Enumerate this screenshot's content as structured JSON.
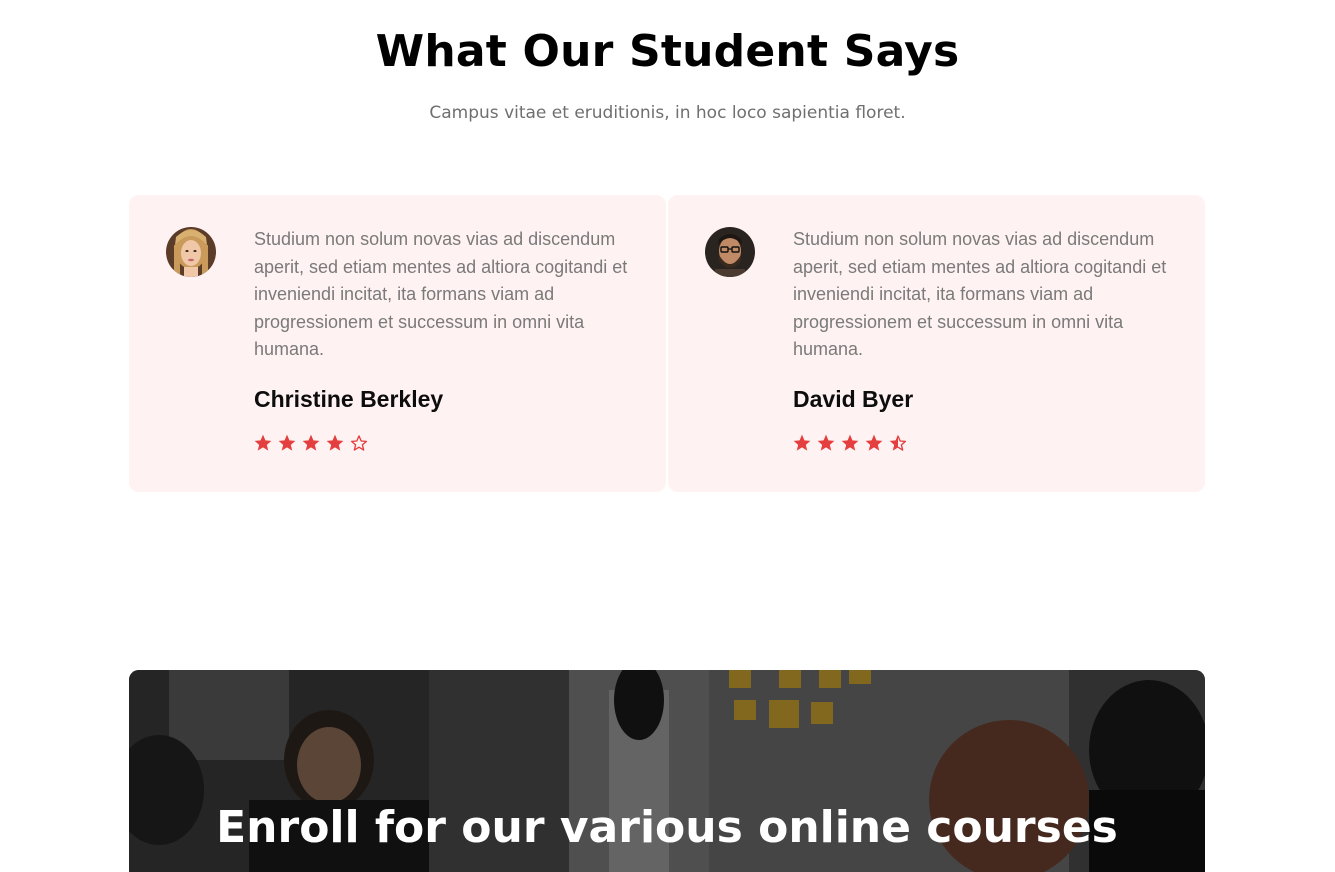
{
  "section": {
    "title": "What Our Student Says",
    "subtitle": "Campus vitae et eruditionis, in hoc loco sapientia floret."
  },
  "testimonials": [
    {
      "quote": "Studium non solum novas vias ad discendum aperit, sed etiam mentes ad altiora cogitandi et inveniendi incitat, ita formans viam ad progressionem et successum in omni vita humana.",
      "author": "Christine Berkley",
      "rating": 4,
      "avatar_icon": "avatar-woman-icon"
    },
    {
      "quote": "Studium non solum novas vias ad discendum aperit, sed etiam mentes ad altiora cogitandi et inveniendi incitat, ita formans viam ad progressionem et successum in omni vita humana.",
      "author": "David Byer",
      "rating": 4.5,
      "avatar_icon": "avatar-man-icon"
    }
  ],
  "banner": {
    "title": "Enroll for our various online courses"
  },
  "colors": {
    "star": "#e53e3e",
    "card_bg": "#fff2f2",
    "text_muted": "#7a7a7a"
  }
}
